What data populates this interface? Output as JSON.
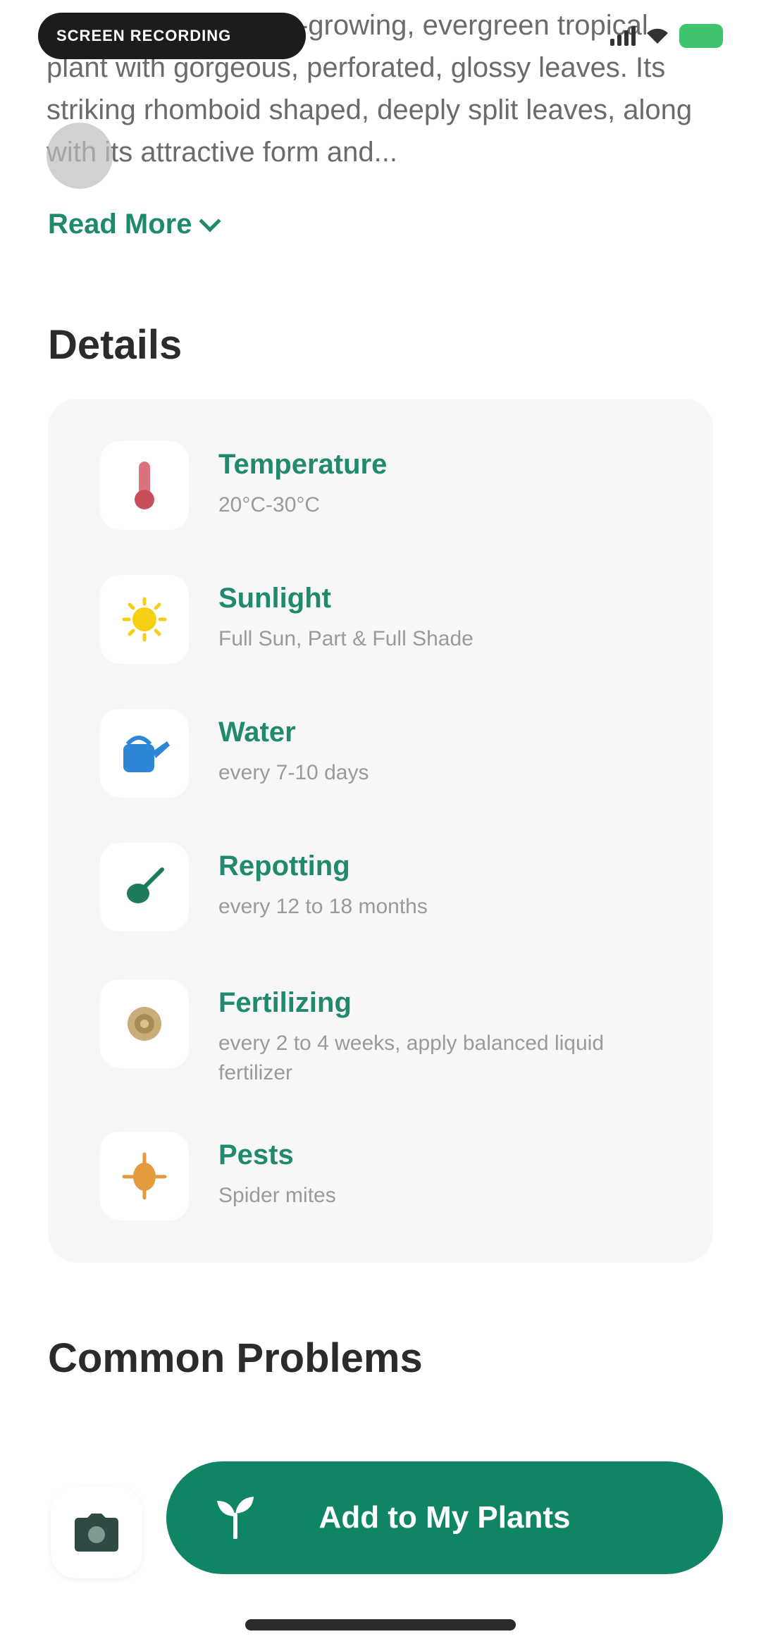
{
  "status_bar": {
    "pill_text": "SCREEN RECORDING",
    "battery_color": "#3ec46d"
  },
  "description": {
    "text": "...is a perennial, fast-growing, evergreen tropical plant with gorgeous, perforated, glossy leaves. Its striking rhomboid shaped, deeply split leaves, along with its attractive form and...",
    "read_more": "Read More"
  },
  "details": {
    "title": "Details",
    "items": [
      {
        "title": "Temperature",
        "value": "20°C-30°C",
        "icon": "thermometer-icon"
      },
      {
        "title": "Sunlight",
        "value": "Full Sun, Part & Full Shade",
        "icon": "sun-icon"
      },
      {
        "title": "Water",
        "value": "every 7-10 days",
        "icon": "watering-can-icon"
      },
      {
        "title": "Repotting",
        "value": "every 12 to 18 months",
        "icon": "shovel-icon"
      },
      {
        "title": "Fertilizing",
        "value": "every 2 to 4 weeks, apply balanced liquid fertilizer",
        "icon": "fertilizer-icon"
      },
      {
        "title": "Pests",
        "value": "Spider mites",
        "icon": "bug-icon"
      }
    ]
  },
  "common_problems": {
    "title": "Common Problems"
  },
  "bottom": {
    "add_button_label": "Add to My Plants",
    "accent_color": "#0f8566"
  }
}
